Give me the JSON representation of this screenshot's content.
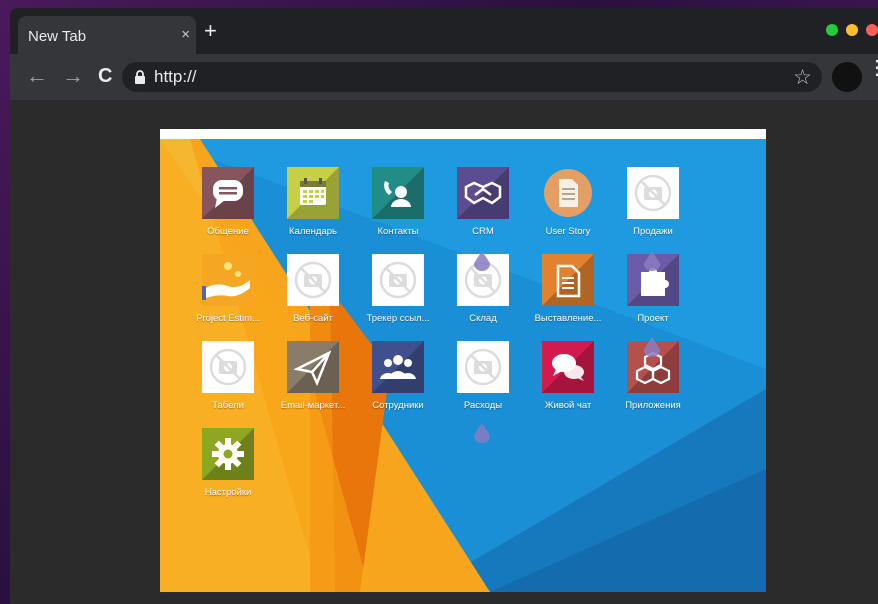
{
  "browser": {
    "tab_title": "New Tab",
    "tab_close": "×",
    "new_tab": "+",
    "url": "http://",
    "back": "←",
    "forward": "→",
    "reload": "C",
    "star": "☆",
    "menu": "⋮"
  },
  "colors": {
    "traffic_green": "#27c93f",
    "traffic_yellow": "#ffbd2e",
    "traffic_red": "#ff5f56",
    "background_blue": "#1e94d6",
    "background_orange": "#f39a1a"
  },
  "apps": [
    {
      "label": "Общение",
      "icon": "chat-icon",
      "color": "#87565d"
    },
    {
      "label": "Календарь",
      "icon": "calendar-icon",
      "color": "#c5d044"
    },
    {
      "label": "Контакты",
      "icon": "contacts-icon",
      "color": "#228c87"
    },
    {
      "label": "CRM",
      "icon": "handshake-icon",
      "color": "#5b4d91"
    },
    {
      "label": "User Story",
      "icon": "document-icon",
      "color": "#e59e63"
    },
    {
      "label": "Продажи",
      "icon": "no-photo-icon",
      "color": "#ffffff"
    },
    {
      "label": "Project Estim...",
      "icon": "hand-coins-icon",
      "color": "#f5a623"
    },
    {
      "label": "Веб-сайт",
      "icon": "no-photo-icon",
      "color": "#ffffff"
    },
    {
      "label": "Трекер ссыл...",
      "icon": "no-photo-icon",
      "color": "#ffffff"
    },
    {
      "label": "Склад",
      "icon": "no-photo-icon",
      "color": "#ffffff"
    },
    {
      "label": "Выставление...",
      "icon": "invoice-icon",
      "color": "#e2822f"
    },
    {
      "label": "Проект",
      "icon": "puzzle-icon",
      "color": "#6c5ca8"
    },
    {
      "label": "Табели",
      "icon": "no-photo-icon",
      "color": "#ffffff"
    },
    {
      "label": "Email-маркет...",
      "icon": "paper-plane-icon",
      "color": "#8a7c6a"
    },
    {
      "label": "Сотрудники",
      "icon": "employees-icon",
      "color": "#40508e"
    },
    {
      "label": "Расходы",
      "icon": "no-photo-icon",
      "color": "#ffffff"
    },
    {
      "label": "Живой чат",
      "icon": "live-chat-icon",
      "color": "#d31a4d"
    },
    {
      "label": "Приложения",
      "icon": "cubes-icon",
      "color": "#b5504c"
    },
    {
      "label": "Настройки",
      "icon": "gear-icon",
      "color": "#8ea621"
    }
  ]
}
